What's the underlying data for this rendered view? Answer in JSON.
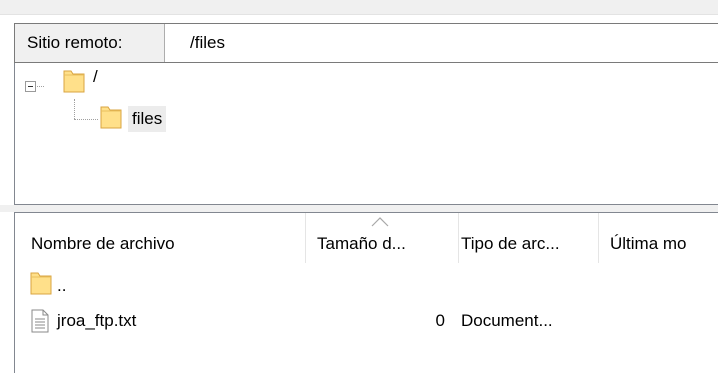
{
  "remote_site": {
    "label": "Sitio remoto:",
    "path_value": "/files"
  },
  "tree": {
    "nodes": [
      {
        "label": "/",
        "icon": "folder-icon",
        "expanded": true,
        "selected": false
      },
      {
        "label": "files",
        "icon": "folder-icon",
        "expanded": false,
        "selected": true
      }
    ]
  },
  "file_list": {
    "columns": [
      {
        "label": "Nombre de archivo"
      },
      {
        "label": "Tamaño d..."
      },
      {
        "label": "Tipo de arc..."
      },
      {
        "label": "Última mo"
      }
    ],
    "sort_indicator": "sort-ascending-icon",
    "rows": [
      {
        "name": "..",
        "size": "",
        "type": "",
        "icon": "folder-icon"
      },
      {
        "name": "jroa_ftp.txt",
        "size": "0",
        "type": "Document...",
        "icon": "text-file-icon"
      }
    ]
  },
  "colors": {
    "folder_fill": "#FFE08A",
    "folder_stroke": "#D9A441",
    "selection_bg": "#ECECEC",
    "border": "#828790"
  }
}
